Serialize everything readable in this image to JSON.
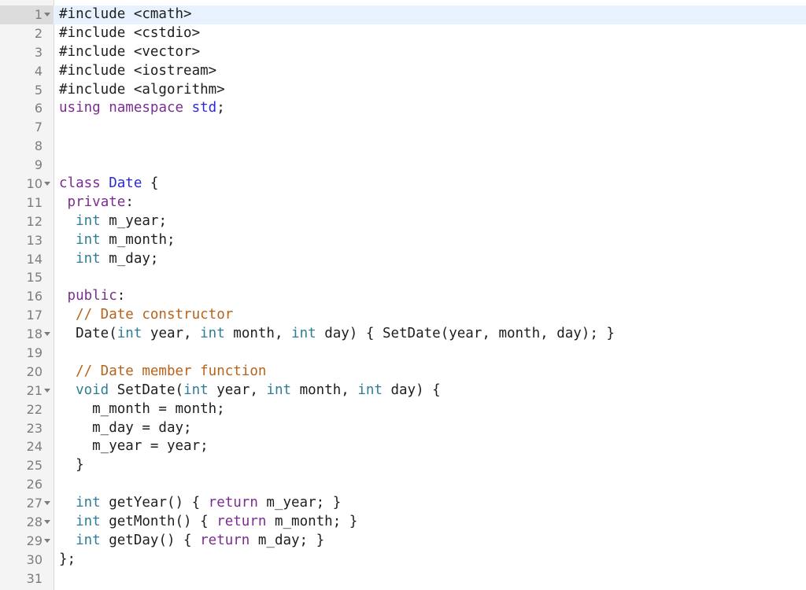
{
  "editor": {
    "active_line": 1,
    "colors": {
      "keyword": "#7a2e8f",
      "type": "#2e7d96",
      "class_name": "#2a2ad8",
      "comment": "#b9631a",
      "text": "#1e1e1e",
      "line_number": "#7d7d7d",
      "gutter_bg": "#f4f4f4",
      "active_line_bg": "#e8f2fe"
    },
    "lines": [
      {
        "n": "1",
        "fold": true,
        "tokens": [
          {
            "t": "#include <cmath>",
            "c": "pre"
          }
        ]
      },
      {
        "n": "2",
        "fold": false,
        "tokens": [
          {
            "t": "#include <cstdio>",
            "c": "pre"
          }
        ]
      },
      {
        "n": "3",
        "fold": false,
        "tokens": [
          {
            "t": "#include <vector>",
            "c": "pre"
          }
        ]
      },
      {
        "n": "4",
        "fold": false,
        "tokens": [
          {
            "t": "#include <iostream>",
            "c": "pre"
          }
        ]
      },
      {
        "n": "5",
        "fold": false,
        "tokens": [
          {
            "t": "#include <algorithm>",
            "c": "pre"
          }
        ]
      },
      {
        "n": "6",
        "fold": false,
        "tokens": [
          {
            "t": "using",
            "c": "kw"
          },
          {
            "t": " ",
            "c": "txt"
          },
          {
            "t": "namespace",
            "c": "kw"
          },
          {
            "t": " ",
            "c": "txt"
          },
          {
            "t": "std",
            "c": "cls"
          },
          {
            "t": ";",
            "c": "txt"
          }
        ]
      },
      {
        "n": "7",
        "fold": false,
        "tokens": []
      },
      {
        "n": "8",
        "fold": false,
        "tokens": []
      },
      {
        "n": "9",
        "fold": false,
        "tokens": []
      },
      {
        "n": "10",
        "fold": true,
        "tokens": [
          {
            "t": "class",
            "c": "kw"
          },
          {
            "t": " ",
            "c": "txt"
          },
          {
            "t": "Date",
            "c": "cls"
          },
          {
            "t": " {",
            "c": "txt"
          }
        ]
      },
      {
        "n": "11",
        "fold": false,
        "tokens": [
          {
            "t": " ",
            "c": "txt"
          },
          {
            "t": "private",
            "c": "kw"
          },
          {
            "t": ":",
            "c": "txt"
          }
        ]
      },
      {
        "n": "12",
        "fold": false,
        "tokens": [
          {
            "t": "  ",
            "c": "txt"
          },
          {
            "t": "int",
            "c": "type"
          },
          {
            "t": " m_year;",
            "c": "txt"
          }
        ]
      },
      {
        "n": "13",
        "fold": false,
        "tokens": [
          {
            "t": "  ",
            "c": "txt"
          },
          {
            "t": "int",
            "c": "type"
          },
          {
            "t": " m_month;",
            "c": "txt"
          }
        ]
      },
      {
        "n": "14",
        "fold": false,
        "tokens": [
          {
            "t": "  ",
            "c": "txt"
          },
          {
            "t": "int",
            "c": "type"
          },
          {
            "t": " m_day;",
            "c": "txt"
          }
        ]
      },
      {
        "n": "15",
        "fold": false,
        "tokens": []
      },
      {
        "n": "16",
        "fold": false,
        "tokens": [
          {
            "t": " ",
            "c": "txt"
          },
          {
            "t": "public",
            "c": "kw"
          },
          {
            "t": ":",
            "c": "txt"
          }
        ]
      },
      {
        "n": "17",
        "fold": false,
        "tokens": [
          {
            "t": "  ",
            "c": "txt"
          },
          {
            "t": "// Date constructor",
            "c": "com"
          }
        ]
      },
      {
        "n": "18",
        "fold": true,
        "tokens": [
          {
            "t": "  Date(",
            "c": "txt"
          },
          {
            "t": "int",
            "c": "type"
          },
          {
            "t": " year, ",
            "c": "txt"
          },
          {
            "t": "int",
            "c": "type"
          },
          {
            "t": " month, ",
            "c": "txt"
          },
          {
            "t": "int",
            "c": "type"
          },
          {
            "t": " day) { SetDate(year, month, day); }",
            "c": "txt"
          }
        ]
      },
      {
        "n": "19",
        "fold": false,
        "tokens": []
      },
      {
        "n": "20",
        "fold": false,
        "tokens": [
          {
            "t": "  ",
            "c": "txt"
          },
          {
            "t": "// Date member function",
            "c": "com"
          }
        ]
      },
      {
        "n": "21",
        "fold": true,
        "tokens": [
          {
            "t": "  ",
            "c": "txt"
          },
          {
            "t": "void",
            "c": "type"
          },
          {
            "t": " SetDate(",
            "c": "txt"
          },
          {
            "t": "int",
            "c": "type"
          },
          {
            "t": " year, ",
            "c": "txt"
          },
          {
            "t": "int",
            "c": "type"
          },
          {
            "t": " month, ",
            "c": "txt"
          },
          {
            "t": "int",
            "c": "type"
          },
          {
            "t": " day) {",
            "c": "txt"
          }
        ]
      },
      {
        "n": "22",
        "fold": false,
        "tokens": [
          {
            "t": "    m_month = month;",
            "c": "txt"
          }
        ]
      },
      {
        "n": "23",
        "fold": false,
        "tokens": [
          {
            "t": "    m_day = day;",
            "c": "txt"
          }
        ]
      },
      {
        "n": "24",
        "fold": false,
        "tokens": [
          {
            "t": "    m_year = year;",
            "c": "txt"
          }
        ]
      },
      {
        "n": "25",
        "fold": false,
        "tokens": [
          {
            "t": "  }",
            "c": "txt"
          }
        ]
      },
      {
        "n": "26",
        "fold": false,
        "tokens": []
      },
      {
        "n": "27",
        "fold": true,
        "tokens": [
          {
            "t": "  ",
            "c": "txt"
          },
          {
            "t": "int",
            "c": "type"
          },
          {
            "t": " getYear() { ",
            "c": "txt"
          },
          {
            "t": "return",
            "c": "kw"
          },
          {
            "t": " m_year; }",
            "c": "txt"
          }
        ]
      },
      {
        "n": "28",
        "fold": true,
        "tokens": [
          {
            "t": "  ",
            "c": "txt"
          },
          {
            "t": "int",
            "c": "type"
          },
          {
            "t": " getMonth() { ",
            "c": "txt"
          },
          {
            "t": "return",
            "c": "kw"
          },
          {
            "t": " m_month; }",
            "c": "txt"
          }
        ]
      },
      {
        "n": "29",
        "fold": true,
        "tokens": [
          {
            "t": "  ",
            "c": "txt"
          },
          {
            "t": "int",
            "c": "type"
          },
          {
            "t": " getDay() { ",
            "c": "txt"
          },
          {
            "t": "return",
            "c": "kw"
          },
          {
            "t": " m_day; }",
            "c": "txt"
          }
        ]
      },
      {
        "n": "30",
        "fold": false,
        "tokens": [
          {
            "t": "};",
            "c": "txt"
          }
        ]
      },
      {
        "n": "31",
        "fold": false,
        "tokens": []
      }
    ]
  }
}
